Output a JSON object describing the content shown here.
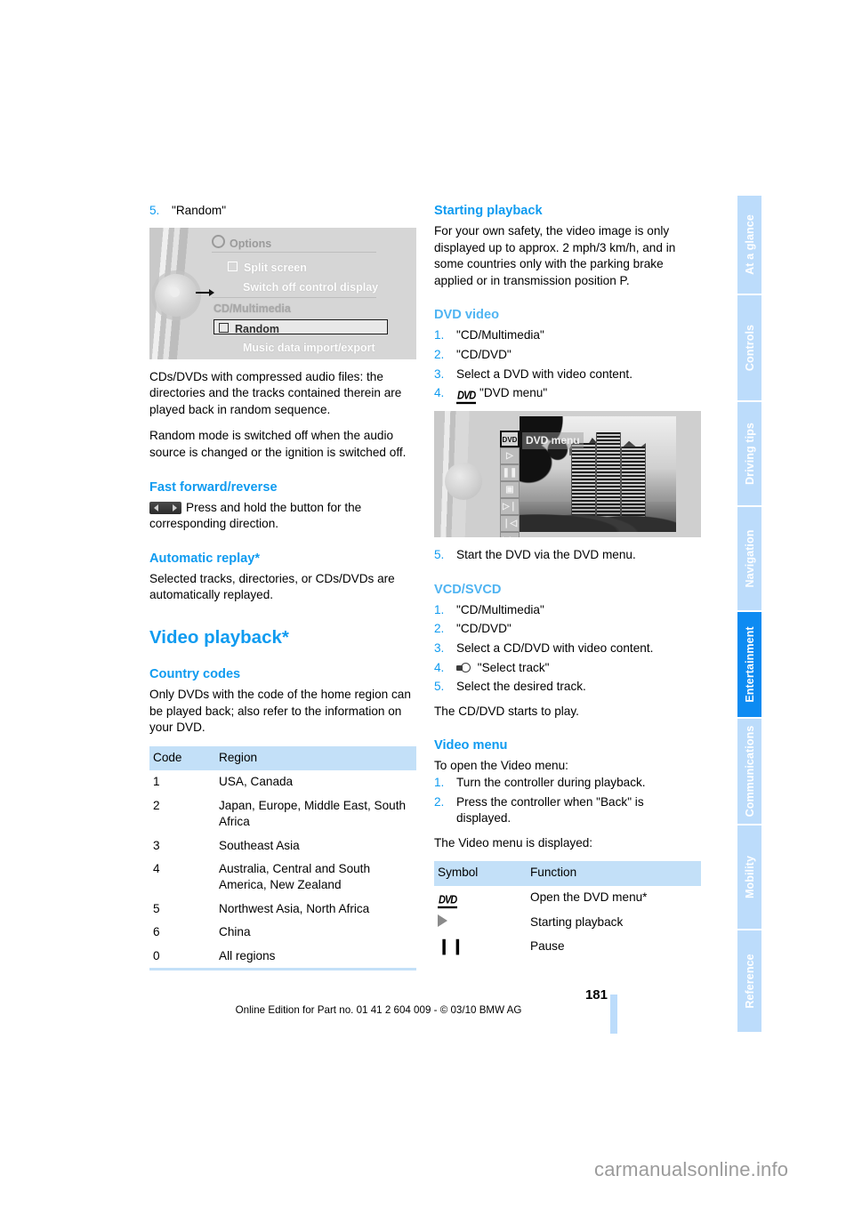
{
  "document": {
    "page_number": "181",
    "edition_line": "Online Edition for Part no. 01 41 2 604 009 - © 03/10 BMW AG",
    "watermark": "carmanualsonline.info",
    "accent_color": "#0f9bf0",
    "tab_active_color": "#0d8bf2",
    "tab_inactive_color": "#bcdcfb",
    "table_header_color": "#c3e0f8"
  },
  "side_tabs": [
    {
      "label": "At a glance",
      "active": false
    },
    {
      "label": "Controls",
      "active": false
    },
    {
      "label": "Driving tips",
      "active": false
    },
    {
      "label": "Navigation",
      "active": false
    },
    {
      "label": "Entertainment",
      "active": true
    },
    {
      "label": "Communications",
      "active": false
    },
    {
      "label": "Mobility",
      "active": false
    },
    {
      "label": "Reference",
      "active": false
    }
  ],
  "left_column": {
    "step_random": {
      "num": "5.",
      "text": "\"Random\""
    },
    "idrive_figure": {
      "menu_title": "Options",
      "items": [
        {
          "label": "Split screen",
          "checkbox": "checked"
        },
        {
          "label": "Switch off control display",
          "checkbox": "none"
        },
        {
          "label": "CD/Multimedia",
          "checkbox": "none"
        },
        {
          "label": "Random",
          "checkbox": "unchecked"
        },
        {
          "label": "Music data import/export",
          "checkbox": "none"
        }
      ]
    },
    "para_1": "CDs/DVDs with compressed audio files: the directories and the tracks contained therein are played back in random sequence.",
    "para_2": "Random mode is switched off when the audio source is changed or the ignition is switched off.",
    "fast_forward": {
      "heading": "Fast forward/reverse",
      "icon": "rocker-button-icon",
      "text": "Press and hold the button for the corresponding direction."
    },
    "automatic_replay": {
      "heading": "Automatic replay*",
      "text": "Selected tracks, directories, or CDs/DVDs are automatically replayed."
    },
    "video_playback_heading": "Video playback*",
    "country_codes": {
      "heading": "Country codes",
      "text": "Only DVDs with the code of the home region can be played back; also refer to the information on your DVD.",
      "columns": [
        "Code",
        "Region"
      ],
      "rows": [
        [
          "1",
          "USA, Canada"
        ],
        [
          "2",
          "Japan, Europe, Middle East, South Africa"
        ],
        [
          "3",
          "Southeast Asia"
        ],
        [
          "4",
          "Australia, Central and South America, New Zealand"
        ],
        [
          "5",
          "Northwest Asia, North Africa"
        ],
        [
          "6",
          "China"
        ],
        [
          "0",
          "All regions"
        ]
      ]
    }
  },
  "right_column": {
    "starting_playback": {
      "heading": "Starting playback",
      "text": "For your own safety, the video image is only displayed up to approx. 2 mph/3 km/h, and in some countries only with the parking brake applied or in transmission position P."
    },
    "dvd_video": {
      "heading": "DVD video",
      "steps": [
        {
          "num": "1.",
          "text": "\"CD/Multimedia\""
        },
        {
          "num": "2.",
          "text": "\"CD/DVD\""
        },
        {
          "num": "3.",
          "text": "Select a DVD with video content."
        },
        {
          "num": "4.",
          "icon": "dvd-logo-icon",
          "text": "\"DVD menu\""
        }
      ],
      "figure": {
        "label": "DVD menu",
        "selected_icon": "dvd-logo-icon"
      },
      "step_5": {
        "num": "5.",
        "text": "Start the DVD via the DVD menu."
      }
    },
    "vcd_svcd": {
      "heading": "VCD/SVCD",
      "steps": [
        {
          "num": "1.",
          "text": "\"CD/Multimedia\""
        },
        {
          "num": "2.",
          "text": "\"CD/DVD\""
        },
        {
          "num": "3.",
          "text": "Select a CD/DVD with video content."
        },
        {
          "num": "4.",
          "icon": "select-track-icon",
          "text": "\"Select track\""
        },
        {
          "num": "5.",
          "text": "Select the desired track."
        }
      ],
      "closing": "The CD/DVD starts to play."
    },
    "video_menu": {
      "heading": "Video menu",
      "intro": "To open the Video menu:",
      "steps": [
        {
          "num": "1.",
          "text": "Turn the controller during playback."
        },
        {
          "num": "2.",
          "text": "Press the controller when \"Back\" is displayed."
        }
      ],
      "closing": "The Video menu is displayed:",
      "columns": [
        "Symbol",
        "Function"
      ],
      "rows": [
        {
          "symbol": "dvd-logo-icon",
          "function": "Open the DVD menu*"
        },
        {
          "symbol": "play-icon",
          "function": "Starting playback"
        },
        {
          "symbol": "pause-icon",
          "function": "Pause"
        }
      ]
    }
  }
}
